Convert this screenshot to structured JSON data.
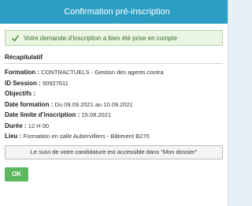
{
  "dialog": {
    "title": "Confirmation pré-inscription",
    "success_message": "Votre demande d'inscription a bien été prise en compte",
    "section_title": "Récapitulatif",
    "fields": {
      "formation": {
        "label": "Formation : ",
        "value": "CONTRACTUELS - Gestion des agents contra"
      },
      "session": {
        "label": "ID Session : ",
        "value": "50927611"
      },
      "objectifs": {
        "label": "Objectifs : ",
        "value": ""
      },
      "date_formation": {
        "label": "Date formation : ",
        "value": "Du 09.09.2021 au 10.09.2021"
      },
      "date_limite": {
        "label": "Date limite d'inscription : ",
        "value": "15.08.2021"
      },
      "duree": {
        "label": "Durée : ",
        "value": "12 H 00"
      },
      "lieu": {
        "label": "Lieu : ",
        "value": "Formation en salle  Aubervilliers - Bâtiment B270"
      }
    },
    "info_text": "Le suivi de votre candidature est accessible dans \"Mon dossier\"",
    "ok_label": "OK"
  },
  "colors": {
    "titlebar": "#2a9fc3",
    "success_bg": "#eaf5e3",
    "success_text": "#3c6b2f",
    "ok_button": "#5cb85c"
  },
  "icons": {
    "success": "check-icon"
  }
}
